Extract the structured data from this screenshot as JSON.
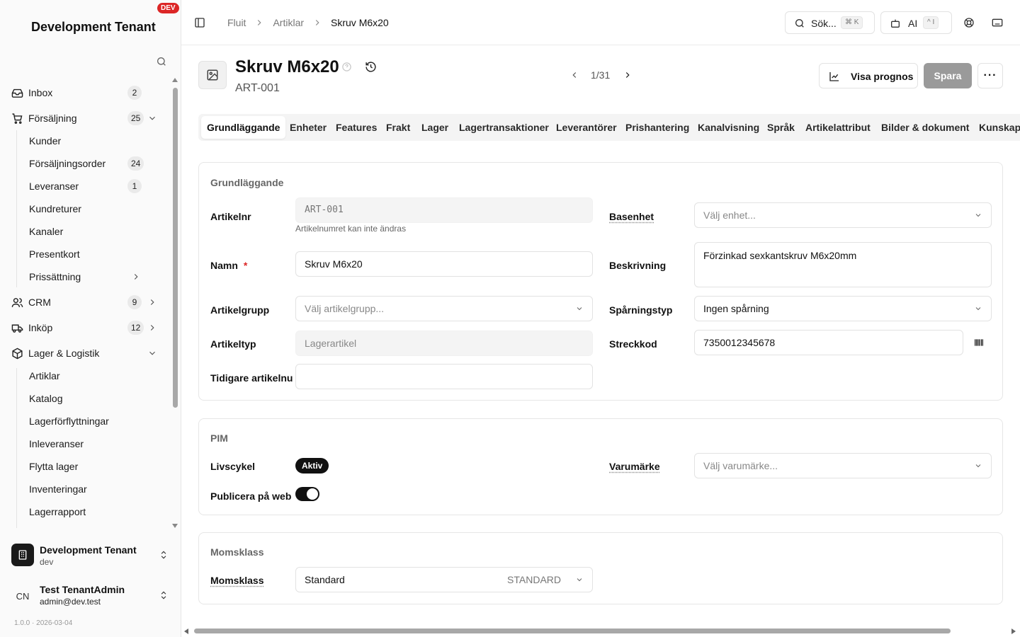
{
  "sidebar": {
    "tenant_title": "Development Tenant",
    "env_badge": "DEV",
    "items": [
      {
        "label": "Inbox",
        "count": "2"
      },
      {
        "label": "Försäljning",
        "count": "25"
      },
      {
        "label": "Kunder"
      },
      {
        "label": "Försäljningsorder",
        "count": "24"
      },
      {
        "label": "Leveranser",
        "count": "1"
      },
      {
        "label": "Kundreturer"
      },
      {
        "label": "Kanaler"
      },
      {
        "label": "Presentkort"
      },
      {
        "label": "Prissättning"
      },
      {
        "label": "CRM",
        "count": "9"
      },
      {
        "label": "Inköp",
        "count": "12"
      },
      {
        "label": "Lager & Logistik"
      },
      {
        "label": "Artiklar"
      },
      {
        "label": "Katalog"
      },
      {
        "label": "Lagerförflyttningar"
      },
      {
        "label": "Inleveranser"
      },
      {
        "label": "Flytta lager"
      },
      {
        "label": "Inventeringar"
      },
      {
        "label": "Lagerrapport"
      }
    ],
    "org": {
      "name": "Development Tenant",
      "slug": "dev"
    },
    "user": {
      "initials": "CN",
      "name": "Test TenantAdmin",
      "email": "admin@dev.test"
    },
    "version": "1.0.0 · 2026-03-04"
  },
  "topbar": {
    "breadcrumbs": [
      "Fluit",
      "Artiklar",
      "Skruv M6x20"
    ],
    "search_label": "Sök...",
    "search_shortcut": "⌘ K",
    "ai_label": "AI",
    "ai_shortcut": "^ I"
  },
  "header": {
    "title": "Skruv M6x20",
    "subtitle": "ART-001",
    "pager": "1/31",
    "forecast_button": "Visa prognos",
    "save_button": "Spara",
    "more_button": "···"
  },
  "tabs": [
    "Grundläggande",
    "Enheter",
    "Features",
    "Frakt",
    "Lager",
    "Lagertransaktioner",
    "Leverantörer",
    "Prishantering",
    "Kanalvisning",
    "Språk",
    "Artikelattribut",
    "Bilder & dokument",
    "Kunskaps"
  ],
  "basic": {
    "title": "Grundläggande",
    "article_no_label": "Artikelnr",
    "article_no_value": "ART-001",
    "article_no_hint": "Artikelnumret kan inte ändras",
    "name_label": "Namn",
    "name_required": "*",
    "name_value": "Skruv M6x20",
    "group_label": "Artikelgrupp",
    "group_placeholder": "Välj artikelgrupp...",
    "type_label": "Artikeltyp",
    "type_value": "Lagerartikel",
    "prev_no_label": "Tidigare artikelnu",
    "prev_no_value": "",
    "base_unit_label": "Basenhet",
    "base_unit_placeholder": "Välj enhet...",
    "description_label": "Beskrivning",
    "description_value": "Förzinkad sexkantskruv M6x20mm",
    "tracking_label": "Spårningstyp",
    "tracking_value": "Ingen spårning",
    "barcode_label": "Streckkod",
    "barcode_value": "7350012345678"
  },
  "pim": {
    "title": "PIM",
    "lifecycle_label": "Livscykel",
    "lifecycle_value": "Aktiv",
    "publish_label": "Publicera på web",
    "brand_label": "Varumärke",
    "brand_placeholder": "Välj varumärke..."
  },
  "vat": {
    "title": "Momsklass",
    "label": "Momsklass",
    "value": "Standard",
    "code": "STANDARD"
  }
}
